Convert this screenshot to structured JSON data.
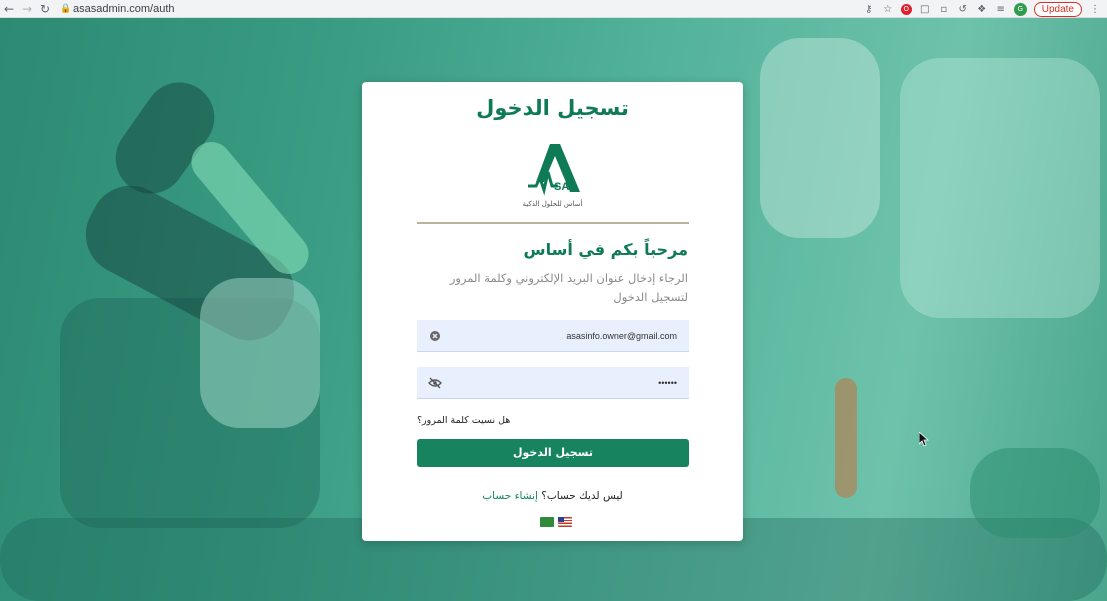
{
  "browser": {
    "url": "asasadmin.com/auth",
    "update_label": "Update",
    "avatar_letter": "G"
  },
  "card": {
    "title": "تسجيل الدخول",
    "logo_text": "SAS",
    "logo_tagline": "أساس للحلول الذكية",
    "welcome": "مرحباً بكم في أساس",
    "subtitle": "الرجاء إدخال عنوان البريد الإلكتروني وكلمة المرور لتسجيل الدخول",
    "email_value": "asasinfo.owner@gmail.com",
    "password_value": "••••••",
    "forgot_label": "هل نسيت كلمة المرور؟",
    "submit_label": "تسجيل الدخول",
    "register_prompt": "ليس لديك حساب؟",
    "register_link": "إنشاء حساب"
  },
  "colors": {
    "brand_green": "#0f7a56",
    "button_green": "#17845f"
  }
}
